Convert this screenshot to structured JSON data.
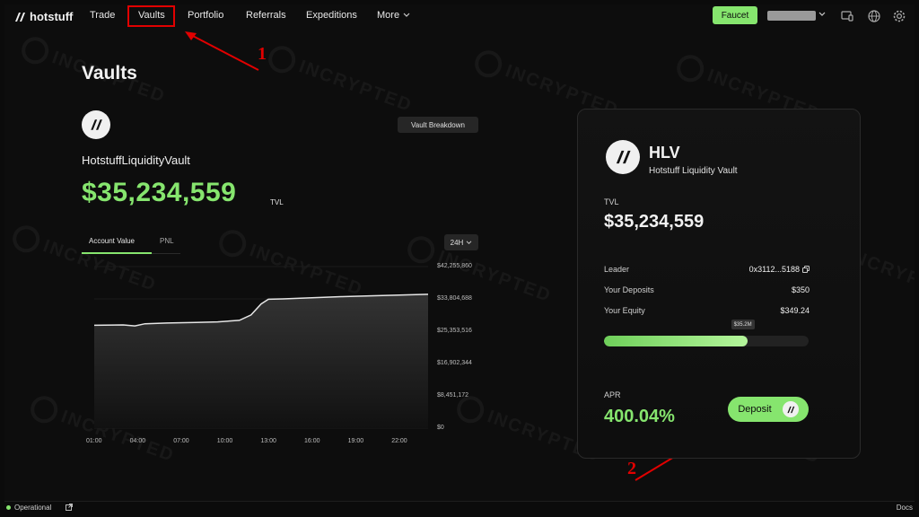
{
  "nav": {
    "logo": "hotstuff",
    "items": [
      "Trade",
      "Vaults",
      "Portfolio",
      "Referrals",
      "Expeditions"
    ],
    "more": "More",
    "faucet": "Faucet",
    "icons": [
      "layout-icon",
      "globe-icon",
      "gear-icon"
    ]
  },
  "watermark": "INCRYPTED",
  "annotations": {
    "one": "1",
    "two": "2",
    "color": "#e10000"
  },
  "page": {
    "title": "Vaults"
  },
  "vault": {
    "breakdown": "Vault Breakdown",
    "name": "HotstuffLiquidityVault",
    "tvl": "$35,234,559",
    "tvl_suffix": "TVL"
  },
  "tabs": {
    "active": "Account Value",
    "inactive": "PNL"
  },
  "range": "24H",
  "chart_data": {
    "type": "area",
    "x": [
      "01:00",
      "04:00",
      "07:00",
      "10:00",
      "13:00",
      "16:00",
      "19:00",
      "22:00"
    ],
    "y_ticks": [
      "$42,255,860",
      "$33,804,688",
      "$25,353,516",
      "$16,902,344",
      "$8,451,172",
      "$0"
    ],
    "ylim": [
      0,
      42255860
    ],
    "points": [
      {
        "t": 0.0,
        "v": 26900000
      },
      {
        "t": 2.0,
        "v": 27000000
      },
      {
        "t": 2.8,
        "v": 26750000
      },
      {
        "t": 3.5,
        "v": 27300000
      },
      {
        "t": 5.0,
        "v": 27500000
      },
      {
        "t": 7.0,
        "v": 27650000
      },
      {
        "t": 8.5,
        "v": 27800000
      },
      {
        "t": 10.0,
        "v": 28200000
      },
      {
        "t": 10.8,
        "v": 29600000
      },
      {
        "t": 11.5,
        "v": 32500000
      },
      {
        "t": 12.0,
        "v": 33700000
      },
      {
        "t": 13.0,
        "v": 33800000
      },
      {
        "t": 15.0,
        "v": 34100000
      },
      {
        "t": 17.0,
        "v": 34400000
      },
      {
        "t": 19.0,
        "v": 34600000
      },
      {
        "t": 21.0,
        "v": 34800000
      },
      {
        "t": 23.0,
        "v": 35000000
      }
    ],
    "x_range": [
      0,
      23
    ],
    "colors": {
      "line": "#e6e6e6",
      "fill": "#2a2a2a"
    }
  },
  "card": {
    "symbol": "HLV",
    "fullname": "Hotstuff Liquidity Vault",
    "tvl_label": "TVL",
    "tvl": "$35,234,559",
    "rows": [
      {
        "label": "Leader",
        "value": "0x3112...5188"
      },
      {
        "label": "Your Deposits",
        "value": "$350"
      },
      {
        "label": "Your Equity",
        "value": "$349.24"
      }
    ],
    "progress": {
      "tip": "$35.2M",
      "fraction": 0.7
    },
    "apr_label": "APR",
    "apr": "400.04%",
    "deposit": "Deposit"
  },
  "status": {
    "text": "Operational",
    "docs": "Docs"
  },
  "colors": {
    "accent": "#86e56e",
    "background": "#0d0d0d"
  }
}
